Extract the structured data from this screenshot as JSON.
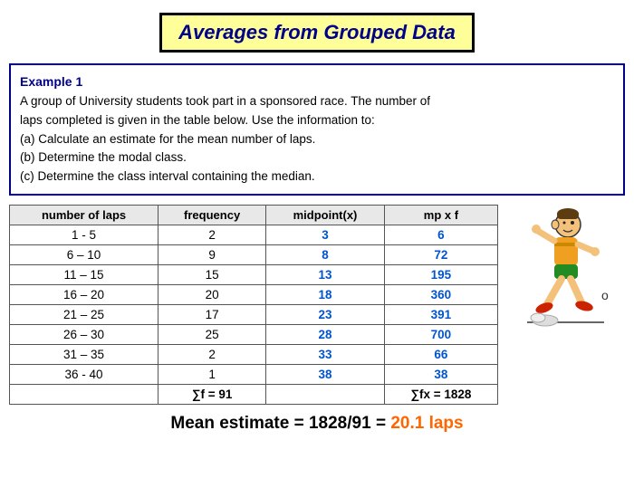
{
  "title": "Averages from Grouped Data",
  "example": {
    "label": "Example 1",
    "text1": "A group of University students took part in a sponsored race. The number of",
    "text2": "laps completed is given in the table below. Use the information to:",
    "text3": "(a) Calculate an estimate for the mean number of laps.",
    "text4": "(b) Determine the modal class.",
    "text5": "(c) Determine the class interval containing the median."
  },
  "table": {
    "headers": [
      "number of laps",
      "frequency",
      "midpoint(x)",
      "mp x f"
    ],
    "rows": [
      {
        "laps": "1 - 5",
        "freq": "2",
        "mid": "3",
        "mpf": "6"
      },
      {
        "laps": "6 – 10",
        "freq": "9",
        "mid": "8",
        "mpf": "72"
      },
      {
        "laps": "11 – 15",
        "freq": "15",
        "mid": "13",
        "mpf": "195"
      },
      {
        "laps": "16 – 20",
        "freq": "20",
        "mid": "18",
        "mpf": "360"
      },
      {
        "laps": "21 – 25",
        "freq": "17",
        "mid": "23",
        "mpf": "391"
      },
      {
        "laps": "26 – 30",
        "freq": "25",
        "mid": "28",
        "mpf": "700"
      },
      {
        "laps": "31 – 35",
        "freq": "2",
        "mid": "33",
        "mpf": "66"
      },
      {
        "laps": "36 - 40",
        "freq": "1",
        "mid": "38",
        "mpf": "38"
      }
    ],
    "sum_freq": "∑f = 91",
    "sum_mpf": "∑fx = 1828"
  },
  "mean_line": {
    "prefix": "Mean estimate = 1828/91 = ",
    "value": "20.1 laps"
  }
}
